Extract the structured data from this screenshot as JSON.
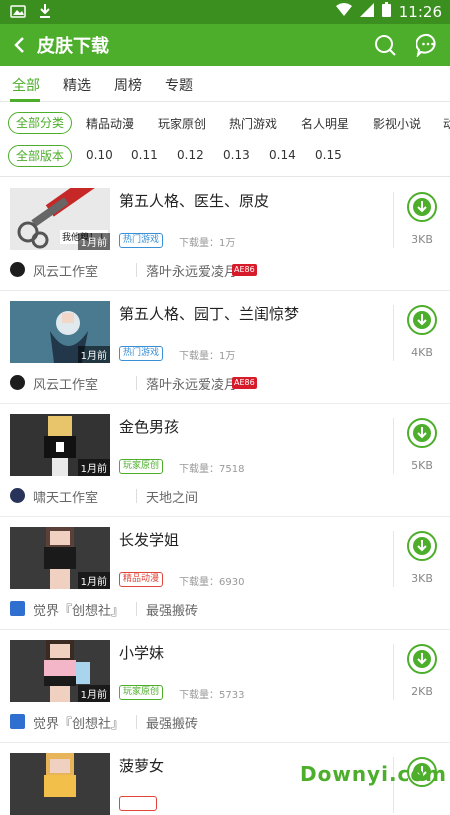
{
  "status": {
    "time": "11:26"
  },
  "header": {
    "title": "皮肤下载"
  },
  "tabs": [
    {
      "label": "全部",
      "active": true
    },
    {
      "label": "精选",
      "active": false
    },
    {
      "label": "周榜",
      "active": false
    },
    {
      "label": "专题",
      "active": false
    }
  ],
  "category_filter": {
    "selected": "全部分类",
    "options": [
      "精品动漫",
      "玩家原创",
      "热门游戏",
      "名人明星",
      "影视小说",
      "动"
    ]
  },
  "version_filter": {
    "selected": "全部版本",
    "options": [
      "0.10",
      "0.11",
      "0.12",
      "0.13",
      "0.14",
      "0.15"
    ]
  },
  "items": [
    {
      "title": "第五人格、医生、原皮",
      "tag": "热门游戏",
      "tag_color": "#3a8fd6",
      "downloads": "下载量：1万",
      "size": "3KB",
      "ago": "1月前",
      "studio": "风云工作室",
      "uploader": "落叶永远爱凌月♡",
      "badge": "AE86"
    },
    {
      "title": "第五人格、园丁、兰闺惊梦",
      "tag": "热门游戏",
      "tag_color": "#3a8fd6",
      "downloads": "下载量：1万",
      "size": "4KB",
      "ago": "1月前",
      "studio": "风云工作室",
      "uploader": "落叶永远爱凌月♡",
      "badge": "AE86"
    },
    {
      "title": "金色男孩",
      "tag": "玩家原创",
      "tag_color": "#4cae2a",
      "downloads": "下载量：7518",
      "size": "5KB",
      "ago": "1月前",
      "studio": "啸天工作室",
      "uploader": "天地之间",
      "badge": ""
    },
    {
      "title": "长发学姐",
      "tag": "精品动漫",
      "tag_color": "#e0463a",
      "downloads": "下载量：6930",
      "size": "3KB",
      "ago": "1月前",
      "studio": "觉界『创想社』",
      "uploader": "最强搬砖",
      "badge": ""
    },
    {
      "title": "小学妹",
      "tag": "玩家原创",
      "tag_color": "#4cae2a",
      "downloads": "下载量：5733",
      "size": "2KB",
      "ago": "1月前",
      "studio": "觉界『创想社』",
      "uploader": "最强搬砖",
      "badge": ""
    },
    {
      "title": "菠萝女",
      "tag": "",
      "tag_color": "#e0463a",
      "downloads": "",
      "size": "",
      "ago": "",
      "studio": "",
      "uploader": "",
      "badge": ""
    }
  ],
  "watermark": "Downyi.com",
  "colors": {
    "accent": "#4cae2a",
    "status_bar": "#3a8f1f"
  }
}
